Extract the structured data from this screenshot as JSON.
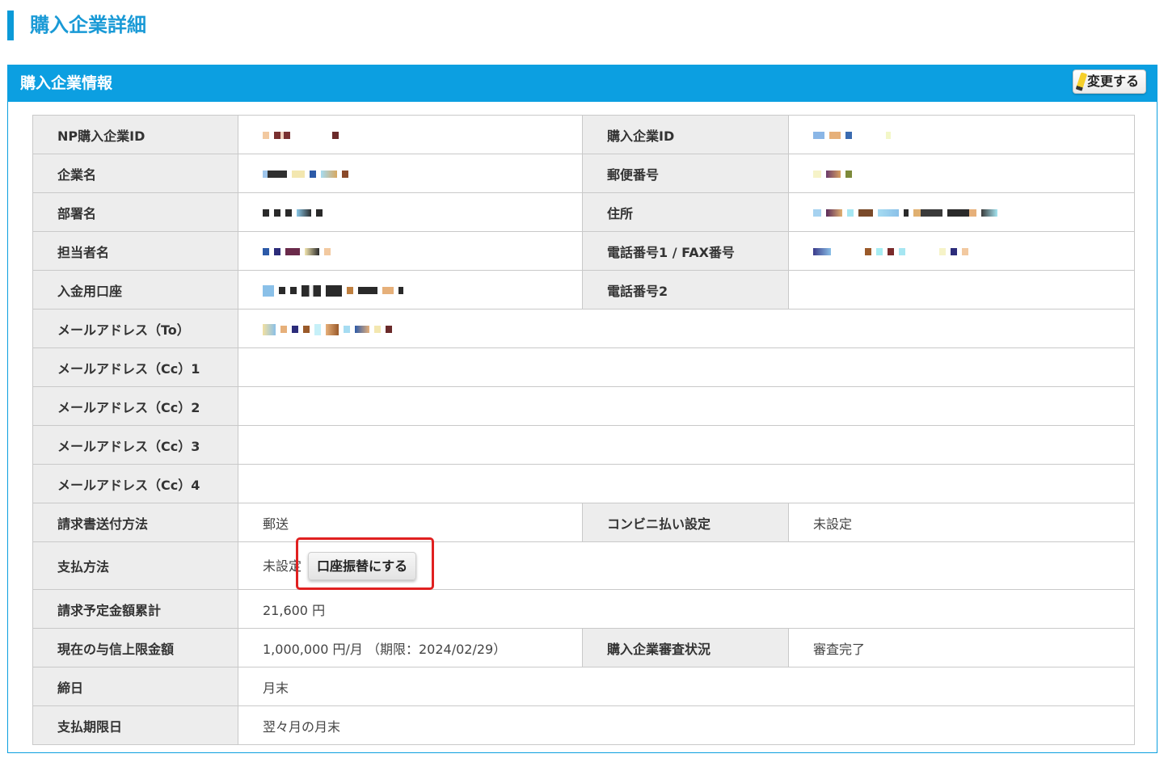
{
  "page": {
    "title": "購入企業詳細"
  },
  "panel": {
    "title": "購入企業情報",
    "edit_label": "変更する"
  },
  "rows": {
    "np_id": {
      "label": "NP購入企業ID"
    },
    "buyer_id": {
      "label": "購入企業ID"
    },
    "company": {
      "label": "企業名"
    },
    "postal": {
      "label": "郵便番号"
    },
    "dept": {
      "label": "部署名"
    },
    "address": {
      "label": "住所"
    },
    "person": {
      "label": "担当者名"
    },
    "phone1": {
      "label": "電話番号1 / FAX番号"
    },
    "account": {
      "label": "入金用口座"
    },
    "phone2": {
      "label": "電話番号2"
    },
    "email_to": {
      "label": "メールアドレス（To）"
    },
    "email_cc1": {
      "label": "メールアドレス（Cc）1"
    },
    "email_cc2": {
      "label": "メールアドレス（Cc）2"
    },
    "email_cc3": {
      "label": "メールアドレス（Cc）3"
    },
    "email_cc4": {
      "label": "メールアドレス（Cc）4"
    },
    "invoice_method": {
      "label": "請求書送付方法",
      "value": "郵送"
    },
    "convenience": {
      "label": "コンビニ払い設定",
      "value": "未設定"
    },
    "payment_method": {
      "label": "支払方法",
      "value": "未設定",
      "button": "口座振替にする"
    },
    "billing_total": {
      "label": "請求予定金額累計",
      "value": "21,600 円"
    },
    "credit_limit": {
      "label": "現在の与信上限金額",
      "value": "1,000,000 円/月 （期限：2024/02/29）"
    },
    "review_status": {
      "label": "購入企業審査状況",
      "value": "審査完了"
    },
    "closing_day": {
      "label": "締日",
      "value": "月末"
    },
    "payment_deadline": {
      "label": "支払期限日",
      "value": "翌々月の月末"
    }
  },
  "colors": {
    "accent": "#0c9fe1",
    "highlight": "#e02020"
  }
}
